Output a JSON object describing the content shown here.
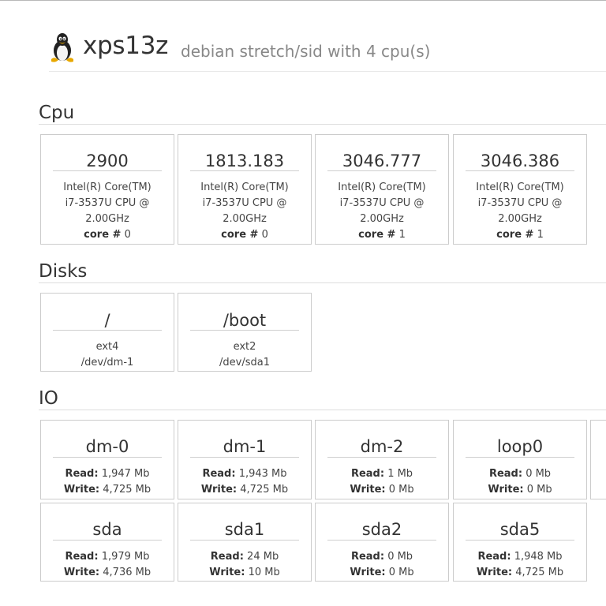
{
  "header": {
    "hostname": "xps13z",
    "os_info": "debian stretch/sid with 4 cpu(s)",
    "logo_icon": "tux-linux-icon"
  },
  "sections": {
    "cpu": "Cpu",
    "disks": "Disks",
    "io": "IO"
  },
  "labels": {
    "core": "core #",
    "read": "Read:",
    "write": "Write:"
  },
  "cpus": [
    {
      "mhz": "2900",
      "model1": "Intel(R) Core(TM)",
      "model2": "i7-3537U CPU @",
      "model3": "2.00GHz",
      "core": "0"
    },
    {
      "mhz": "1813.183",
      "model1": "Intel(R) Core(TM)",
      "model2": "i7-3537U CPU @",
      "model3": "2.00GHz",
      "core": "0"
    },
    {
      "mhz": "3046.777",
      "model1": "Intel(R) Core(TM)",
      "model2": "i7-3537U CPU @",
      "model3": "2.00GHz",
      "core": "1"
    },
    {
      "mhz": "3046.386",
      "model1": "Intel(R) Core(TM)",
      "model2": "i7-3537U CPU @",
      "model3": "2.00GHz",
      "core": "1"
    }
  ],
  "disks": [
    {
      "mount": "/",
      "fs": "ext4",
      "device": "/dev/dm-1"
    },
    {
      "mount": "/boot",
      "fs": "ext2",
      "device": "/dev/sda1"
    }
  ],
  "io": [
    {
      "name": "dm-0",
      "read": "1,947 Mb",
      "write": "4,725 Mb"
    },
    {
      "name": "dm-1",
      "read": "1,943 Mb",
      "write": "4,725 Mb"
    },
    {
      "name": "dm-2",
      "read": "1 Mb",
      "write": "0 Mb"
    },
    {
      "name": "loop0",
      "read": "0 Mb",
      "write": "0 Mb"
    },
    {
      "name": "sda",
      "read": "1,979 Mb",
      "write": "4,736 Mb"
    },
    {
      "name": "sda1",
      "read": "24 Mb",
      "write": "10 Mb"
    },
    {
      "name": "sda2",
      "read": "0 Mb",
      "write": "0 Mb"
    },
    {
      "name": "sda5",
      "read": "1,948 Mb",
      "write": "4,725 Mb"
    }
  ]
}
